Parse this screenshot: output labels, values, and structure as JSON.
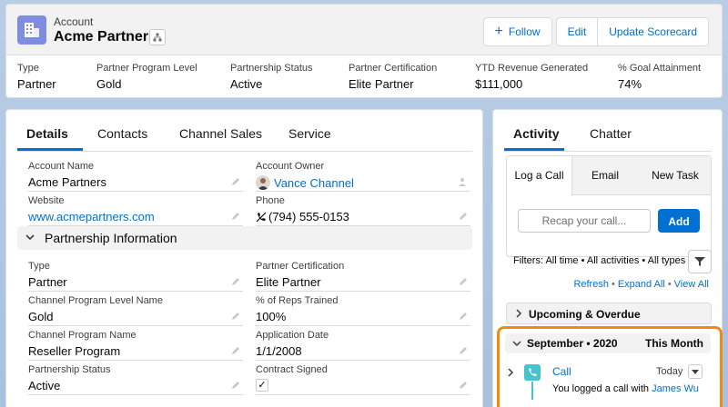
{
  "header": {
    "object_label": "Account",
    "record_name": "Acme Partners",
    "buttons": {
      "follow": "Follow",
      "edit": "Edit",
      "update": "Update Scorecard"
    },
    "highlights": [
      {
        "label": "Type",
        "value": "Partner"
      },
      {
        "label": "Partner Program Level",
        "value": "Gold"
      },
      {
        "label": "Partnership Status",
        "value": "Active"
      },
      {
        "label": "Partner Certification",
        "value": "Elite Partner"
      },
      {
        "label": "YTD Revenue Generated",
        "value": "$111,000"
      },
      {
        "label": "% Goal Attainment",
        "value": "74%"
      }
    ]
  },
  "left": {
    "tabs": [
      "Details",
      "Contacts",
      "Channel Sales",
      "Service"
    ],
    "fields_top": [
      {
        "label": "Account Name",
        "value": "Acme Partners"
      },
      {
        "label": "Account Owner",
        "value": "Vance Channel"
      },
      {
        "label": "Website",
        "value": "www.acmepartners.com"
      },
      {
        "label": "Phone",
        "value": "(794) 555-0153"
      }
    ],
    "section": "Partnership Information",
    "fields_section": [
      {
        "label": "Type",
        "value": "Partner"
      },
      {
        "label": "Partner Certification",
        "value": "Elite Partner"
      },
      {
        "label": "Channel Program Level Name",
        "value": "Gold"
      },
      {
        "label": "% of Reps Trained",
        "value": "100%"
      },
      {
        "label": "Channel Program Name",
        "value": "Reseller Program"
      },
      {
        "label": "Application Date",
        "value": "1/1/2008"
      },
      {
        "label": "Partnership Status",
        "value": "Active"
      },
      {
        "label": "Contract Signed",
        "value": "✓"
      }
    ]
  },
  "right": {
    "tabs": [
      "Activity",
      "Chatter"
    ],
    "composer_tabs": [
      "Log a Call",
      "Email",
      "New Task"
    ],
    "recap_placeholder": "Recap your call...",
    "add_label": "Add",
    "filters": "Filters: All time • All activities • All types",
    "links": [
      "Refresh",
      "Expand All",
      "View All"
    ],
    "upcoming": "Upcoming & Overdue",
    "month": "September • 2020",
    "month_right": "This Month",
    "call": {
      "title": "Call",
      "date": "Today",
      "desc_prefix": "You logged a call with",
      "who": "James Wu"
    }
  },
  "colors": {
    "brand": "#0070d2",
    "account_icon": "#7f8de1",
    "call_icon": "#48c3cc",
    "highlight": "#f08a17"
  }
}
